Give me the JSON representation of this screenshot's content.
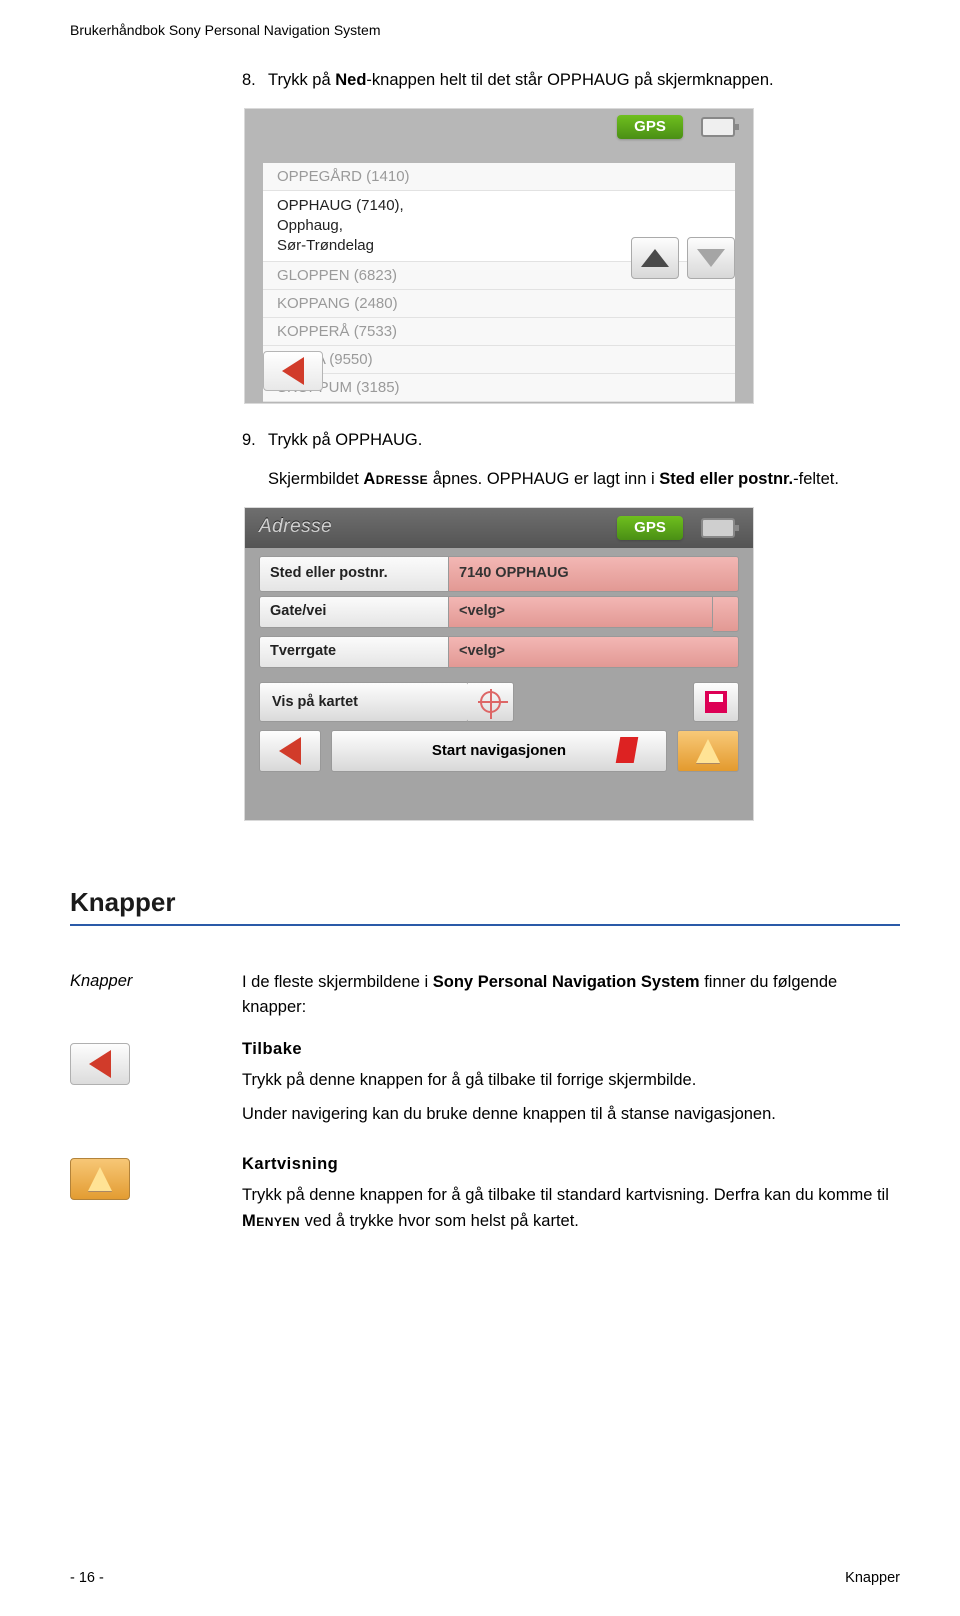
{
  "header": "Brukerhåndbok Sony Personal Navigation System",
  "step8": {
    "num": "8.",
    "text_pre": "Trykk på ",
    "bold1": "Ned",
    "text_mid": "-knappen helt til det står OPPHAUG på skjermknappen."
  },
  "screenshot1": {
    "gps": "GPS",
    "row_dim_top": "OPPEGÅRD (1410)",
    "row_sel_l1": "OPPHAUG (7140),",
    "row_sel_l2": "Opphaug,",
    "row_sel_l3": "Sør-Trøndelag",
    "dim1": "GLOPPEN (6823)",
    "dim2": "KOPPANG (2480)",
    "dim3": "KOPPERÅ (7533)",
    "dim4": "LOPPA (9550)",
    "dim5": "SKOPPUM (3185)"
  },
  "step9": {
    "num": "9.",
    "text": "Trykk på OPPHAUG.",
    "line2_pre": "Skjermbildet ",
    "line2_sc": "Adresse",
    "line2_mid": " åpnes. OPPHAUG er lagt inn i ",
    "line2_bold": "Sted eller postnr.",
    "line2_suf": "-feltet."
  },
  "screenshot2": {
    "title": "Adresse",
    "gps": "GPS",
    "rows": {
      "sted_label": "Sted eller postnr.",
      "sted_val": "7140 OPPHAUG",
      "gate_label": "Gate/vei",
      "gate_val": "<velg>",
      "tverr_label": "Tverrgate",
      "tverr_val": "<velg>"
    },
    "vis": "Vis på kartet",
    "start": "Start navigasjonen"
  },
  "section": "Knapper",
  "knapper": {
    "side_label": "Knapper",
    "intro_pre": "I de fleste skjermbildene i ",
    "intro_bold": "Sony Personal Navigation System",
    "intro_suf": " finner du følgende knapper:",
    "tilbake": {
      "title": "Tilbake",
      "p1": "Trykk på denne knappen for å gå tilbake til forrige skjermbilde.",
      "p2": "Under navigering kan du bruke denne knappen til å stanse navigasjonen."
    },
    "kart": {
      "title": "Kartvisning",
      "p1": "Trykk på denne knappen for å gå tilbake til standard kartvisning. Derfra kan du komme til ",
      "p1_sc": "Menyen",
      "p1_suf": " ved å trykke hvor som helst på kartet."
    }
  },
  "footer": {
    "left": "- 16 -",
    "right": "Knapper"
  }
}
